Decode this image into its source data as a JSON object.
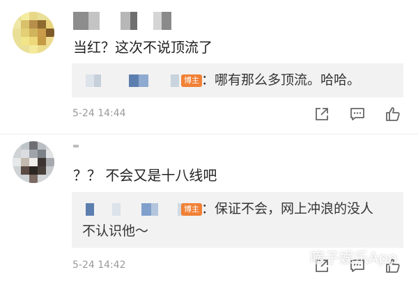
{
  "comments": [
    {
      "content": "当红？这次不说顶流了",
      "reply": {
        "badge": "博主",
        "text": "：哪有那么多顶流。哈哈。"
      },
      "time": "5-24 14:44"
    },
    {
      "content": "？？ 不会又是十八线吧",
      "reply": {
        "badge": "博主",
        "text_line1": "：保证不会，网上冲浪的没人",
        "text_line2": "不认识他～"
      },
      "time": "5-24 14:42"
    }
  ],
  "actions": [
    "share-icon",
    "comment-icon",
    "like-icon"
  ],
  "watermark": "嘀子娱乐App",
  "colors": {
    "badge": "#f08136",
    "reply_bg": "#f2f2f2",
    "time": "#999999"
  }
}
